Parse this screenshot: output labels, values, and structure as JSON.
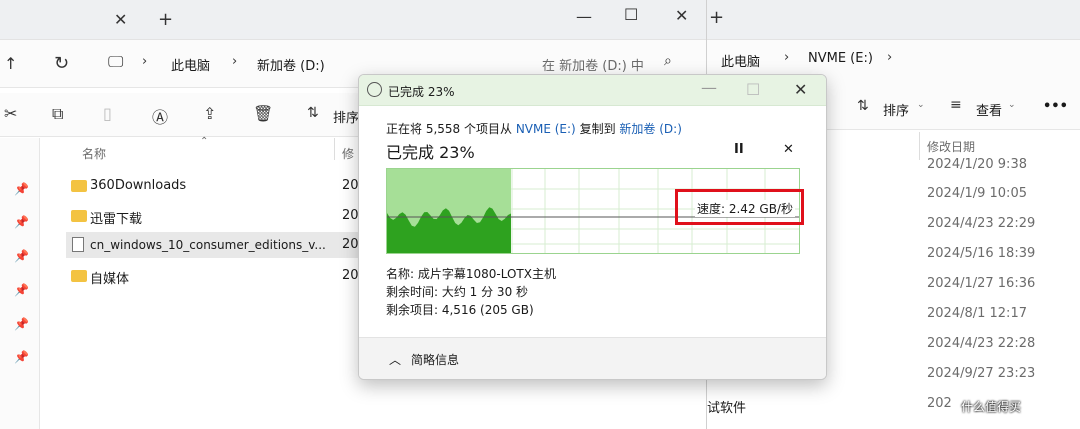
{
  "left_window": {
    "tab_close": "✕",
    "tab_add": "+",
    "window_controls": {
      "min": "—",
      "max": "☐",
      "close": "✕"
    },
    "breadcrumb": [
      "此电脑",
      "新加卷 (D:)"
    ],
    "search_placeholder": "在 新加卷 (D:) 中",
    "toolbar": {
      "sort_label": "排序"
    },
    "columns": {
      "name": "名称",
      "modified": "修"
    },
    "files": [
      {
        "name": "360Downloads",
        "date": "20",
        "type": "folder"
      },
      {
        "name": "迅雷下载",
        "date": "20",
        "type": "folder"
      },
      {
        "name": "cn_windows_10_consumer_editions_v...",
        "date": "20",
        "type": "file"
      },
      {
        "name": "自媒体",
        "date": "20",
        "type": "folder"
      }
    ]
  },
  "right_window": {
    "tab_add": "+",
    "breadcrumb": [
      "此电脑",
      "NVME (E:)"
    ],
    "toolbar": {
      "sort_label": "排序",
      "view_label": "查看",
      "more": "•••"
    },
    "column_modified": "修改日期",
    "dates": [
      "2024/1/20 9:38",
      "2024/1/9 10:05",
      "2024/4/23 22:29",
      "2024/5/16 18:39",
      "2024/1/27 16:36",
      "2024/8/1 12:17",
      "2024/4/23 22:28",
      "2024/9/27 23:23",
      "202"
    ],
    "bottom_item": "试软件",
    "watermark": "什么值得买"
  },
  "dialog": {
    "title": "已完成 23%",
    "copy_prefix": "正在将 5,558 个项目从",
    "source": "NVME (E:)",
    "copy_mid": "复制到",
    "dest": "新加卷 (D:)",
    "progress_heading": "已完成 23%",
    "progress_fraction": 0.23,
    "speed": "速度: 2.42 GB/秒",
    "name_line": "名称: 成片字幕1080-LOTX主机",
    "time_line": "剩余时间: 大约 1 分 30 秒",
    "items_line": "剩余项目: 4,516 (205 GB)",
    "details_toggle": "简略信息",
    "colors": {
      "graph_fill": "#2ea21f",
      "graph_bg_done": "#a6df97",
      "highlight": "#e0101b",
      "link": "#1a5fb4"
    }
  }
}
